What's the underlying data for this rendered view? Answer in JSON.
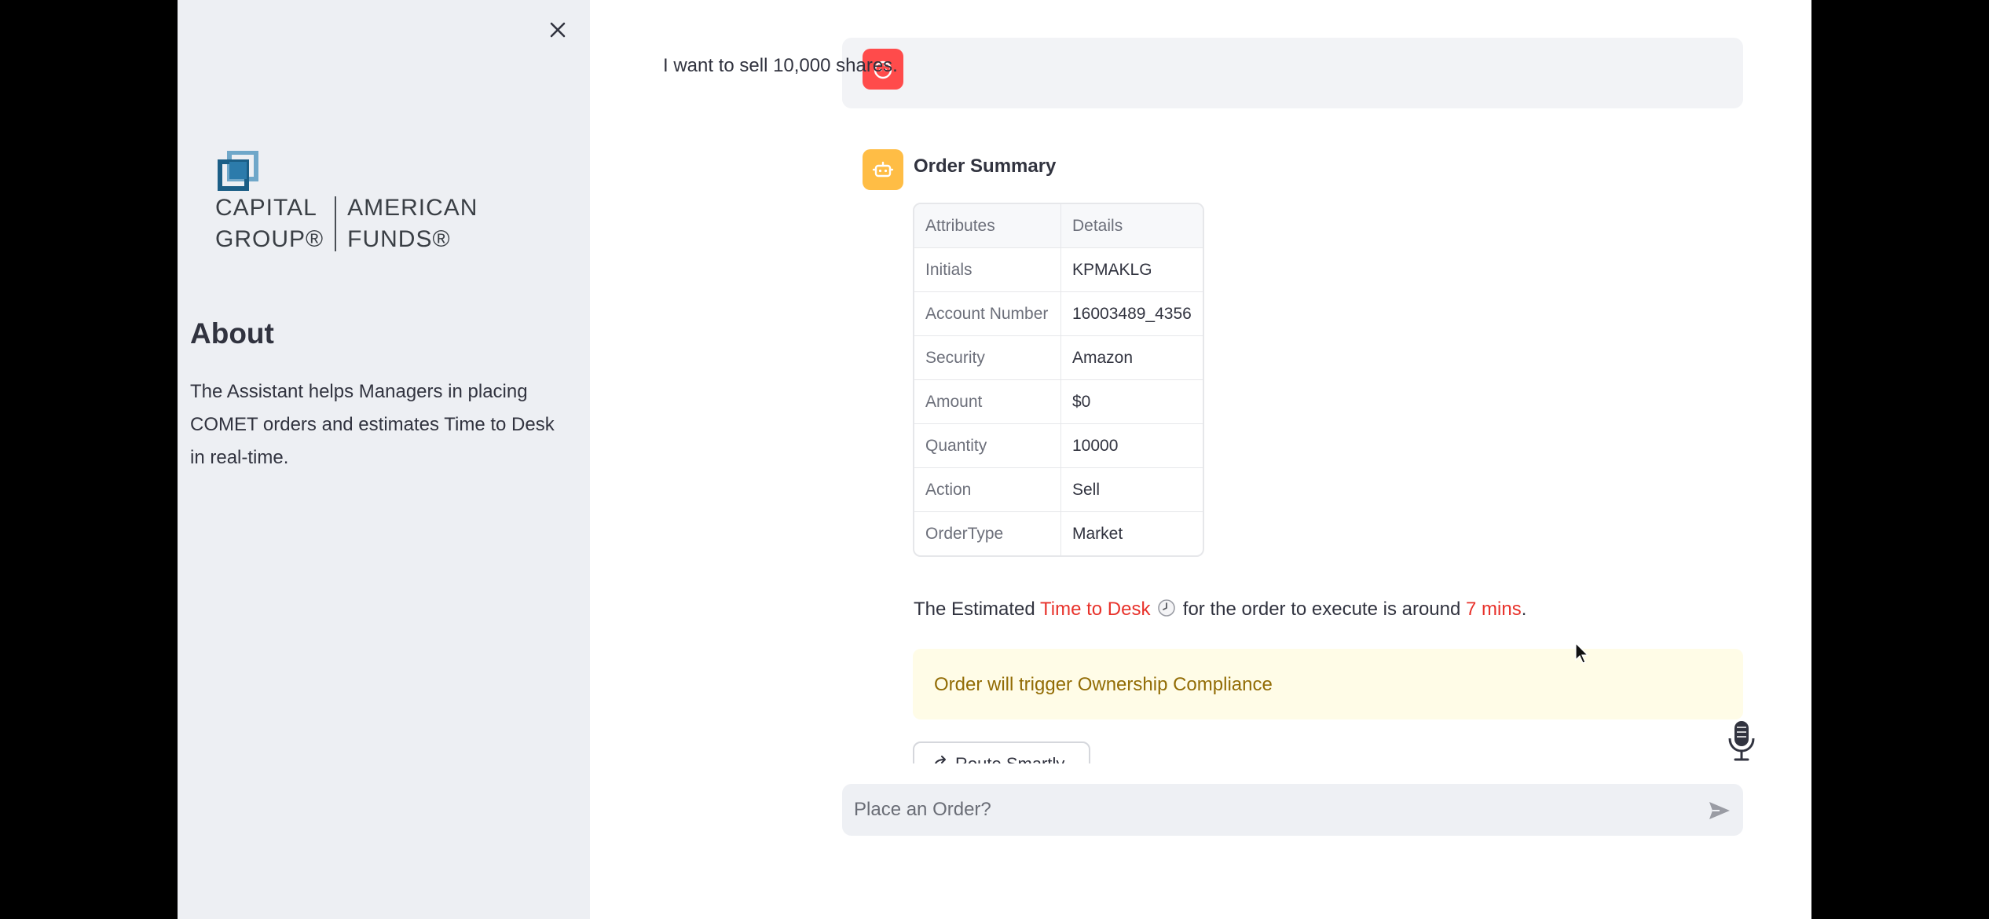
{
  "sidebar": {
    "logo": {
      "left_line1": "CAPITAL",
      "left_line2": "GROUP®",
      "right_line1": "AMERICAN",
      "right_line2": "FUNDS®"
    },
    "about_title": "About",
    "about_text": "The Assistant helps Managers in placing COMET orders and estimates Time to Desk in real-time."
  },
  "chat": {
    "user_message": "I want to sell 10,000 shares.",
    "order_summary_title": "Order Summary",
    "table": {
      "headers": [
        "Attributes",
        "Details"
      ],
      "rows": [
        {
          "attribute": "Initials",
          "detail": "KPMAKLG"
        },
        {
          "attribute": "Account Number",
          "detail": "16003489_4356"
        },
        {
          "attribute": "Security",
          "detail": "Amazon"
        },
        {
          "attribute": "Amount",
          "detail": "$0"
        },
        {
          "attribute": "Quantity",
          "detail": "10000"
        },
        {
          "attribute": "Action",
          "detail": "Sell"
        },
        {
          "attribute": "OrderType",
          "detail": "Market"
        }
      ]
    },
    "estimate": {
      "prefix": "The Estimated ",
      "highlight": "Time to Desk",
      "middle": " for the order to execute is around ",
      "time": "7 mins",
      "suffix": "."
    },
    "warning": "Order will trigger Ownership Compliance",
    "route_button": "Route Smartly"
  },
  "input": {
    "placeholder": "Place an Order?"
  },
  "colors": {
    "sidebar_bg": "#edeff3",
    "user_avatar": "#ff4b4b",
    "bot_avatar": "#ffbd45",
    "highlight_red": "#e8322b",
    "warning_bg": "#fffce7",
    "warning_text": "#926c05"
  },
  "icons": [
    "close-icon",
    "capital-group-logo",
    "user-avatar-icon",
    "bot-avatar-icon",
    "clock-icon",
    "route-icon",
    "microphone-icon",
    "send-icon"
  ]
}
